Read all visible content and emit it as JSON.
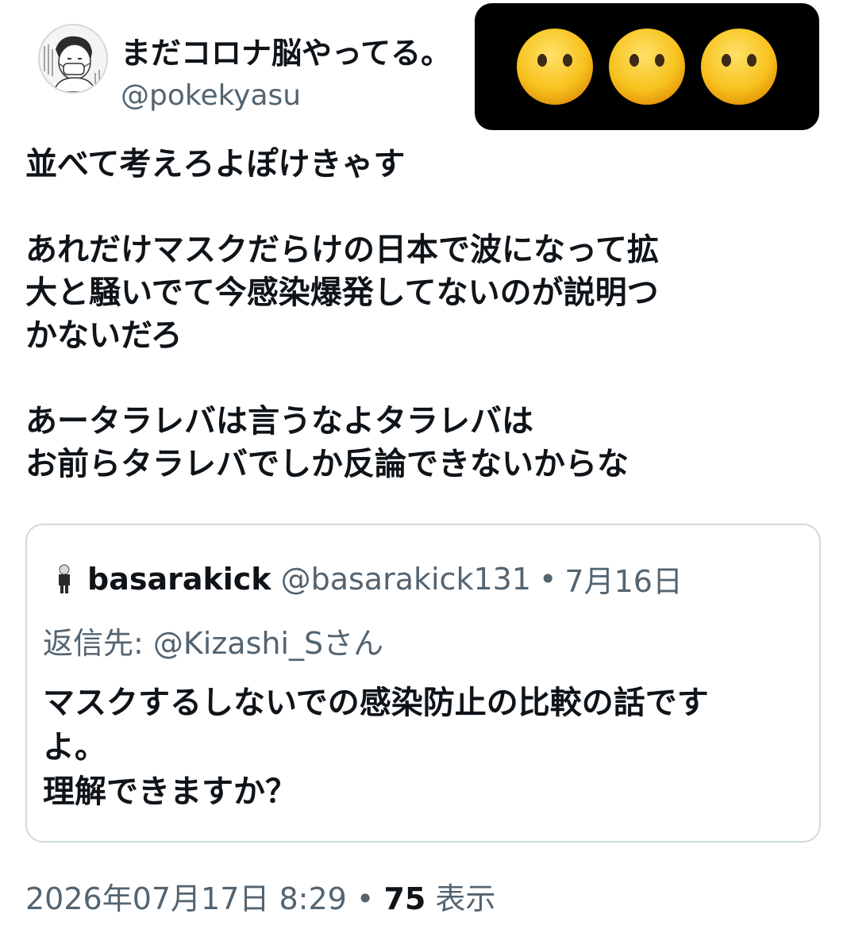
{
  "tweet": {
    "display_name": "まだコロナ脳やってる。",
    "handle": "@pokekyasu",
    "paragraphs": [
      "並べて考えろよぽけきゃす",
      "あれだけマスクだらけの日本で波になって拡\n大と騒いでて今感染爆発してないのが説明つ\nかないだろ",
      "あータラレバは言うなよタラレバは\nお前らタラレバでしか反論できないからな"
    ],
    "timestamp": "2026年07月17日 8:29",
    "separator": "•",
    "views_count": "75",
    "views_label": "表示"
  },
  "quote": {
    "name": "basarakick",
    "handle": "@basarakick131",
    "separator": "•",
    "date": "7月16日",
    "reply_to": "返信先: @Kizashi_Sさん",
    "text": "マスクするしないでの感染防止の比較の話です\nよ。\n理解できますか？"
  },
  "overlay": {
    "icons": [
      "neutral-face-icon",
      "neutral-face-icon",
      "neutral-face-icon"
    ],
    "background": "#000000",
    "face_color": "#f7c21d"
  },
  "colors": {
    "text_primary": "#0f1419",
    "text_secondary": "#536471",
    "border": "#cfd9de"
  }
}
